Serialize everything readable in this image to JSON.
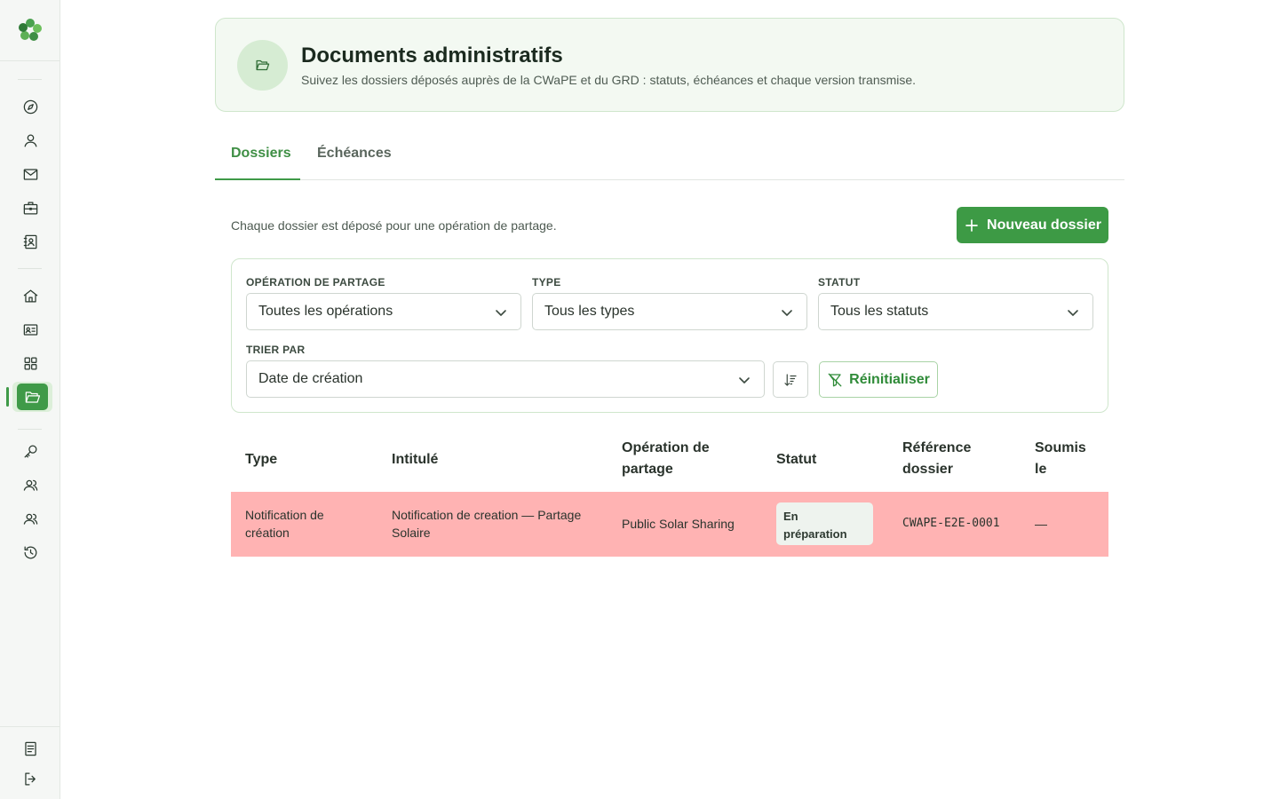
{
  "sidebar": {
    "logo": "clover-logo-icon",
    "groups": [
      [
        "compass-icon",
        "user-icon",
        "mail-icon",
        "briefcase-icon",
        "contact-book-icon"
      ],
      [
        "home-icon",
        "id-card-icon",
        "grid-icon",
        "folder-open-icon"
      ],
      [
        "key-icon",
        "users-icon",
        "users-alt-icon",
        "history-icon"
      ]
    ],
    "bottom": [
      "notes-icon",
      "logout-icon"
    ],
    "active": "folder-open-icon"
  },
  "header": {
    "title": "Documents administratifs",
    "subtitle": "Suivez les dossiers déposés auprès de la CWaPE et du GRD : statuts, échéances et chaque version transmise."
  },
  "tabs": [
    {
      "label": "Dossiers",
      "active": true
    },
    {
      "label": "Échéances",
      "active": false
    }
  ],
  "intro": "Chaque dossier est déposé pour une opération de partage.",
  "new_button": "Nouveau dossier",
  "filters": {
    "operation": {
      "label": "Opération de partage",
      "value": "Toutes les opérations"
    },
    "type": {
      "label": "Type",
      "value": "Tous les types"
    },
    "status": {
      "label": "Statut",
      "value": "Tous les statuts"
    },
    "sort": {
      "label": "Trier par",
      "value": "Date de création"
    },
    "reset": "Réinitialiser"
  },
  "table": {
    "headers": {
      "type": "Type",
      "title": "Intitulé",
      "operation_l1": "Opération de",
      "operation_l2": "partage",
      "status": "Statut",
      "ref_l1": "Référence",
      "ref_l2": "dossier",
      "submitted_l1": "Soumis",
      "submitted_l2": "le"
    },
    "rows": [
      {
        "type_l1": "Notification de",
        "type_l2": "création",
        "title_l1": "Notification de creation — Partage",
        "title_l2": "Solaire",
        "operation": "Public Solar Sharing",
        "status_l1": "En",
        "status_l2": "préparation",
        "reference": "CWAPE-E2E-0001",
        "submitted": "—"
      }
    ]
  },
  "colors": {
    "accent": "#3f9a48",
    "row_highlight": "#ffb3b3",
    "header_bg": "#f3f9f2"
  }
}
